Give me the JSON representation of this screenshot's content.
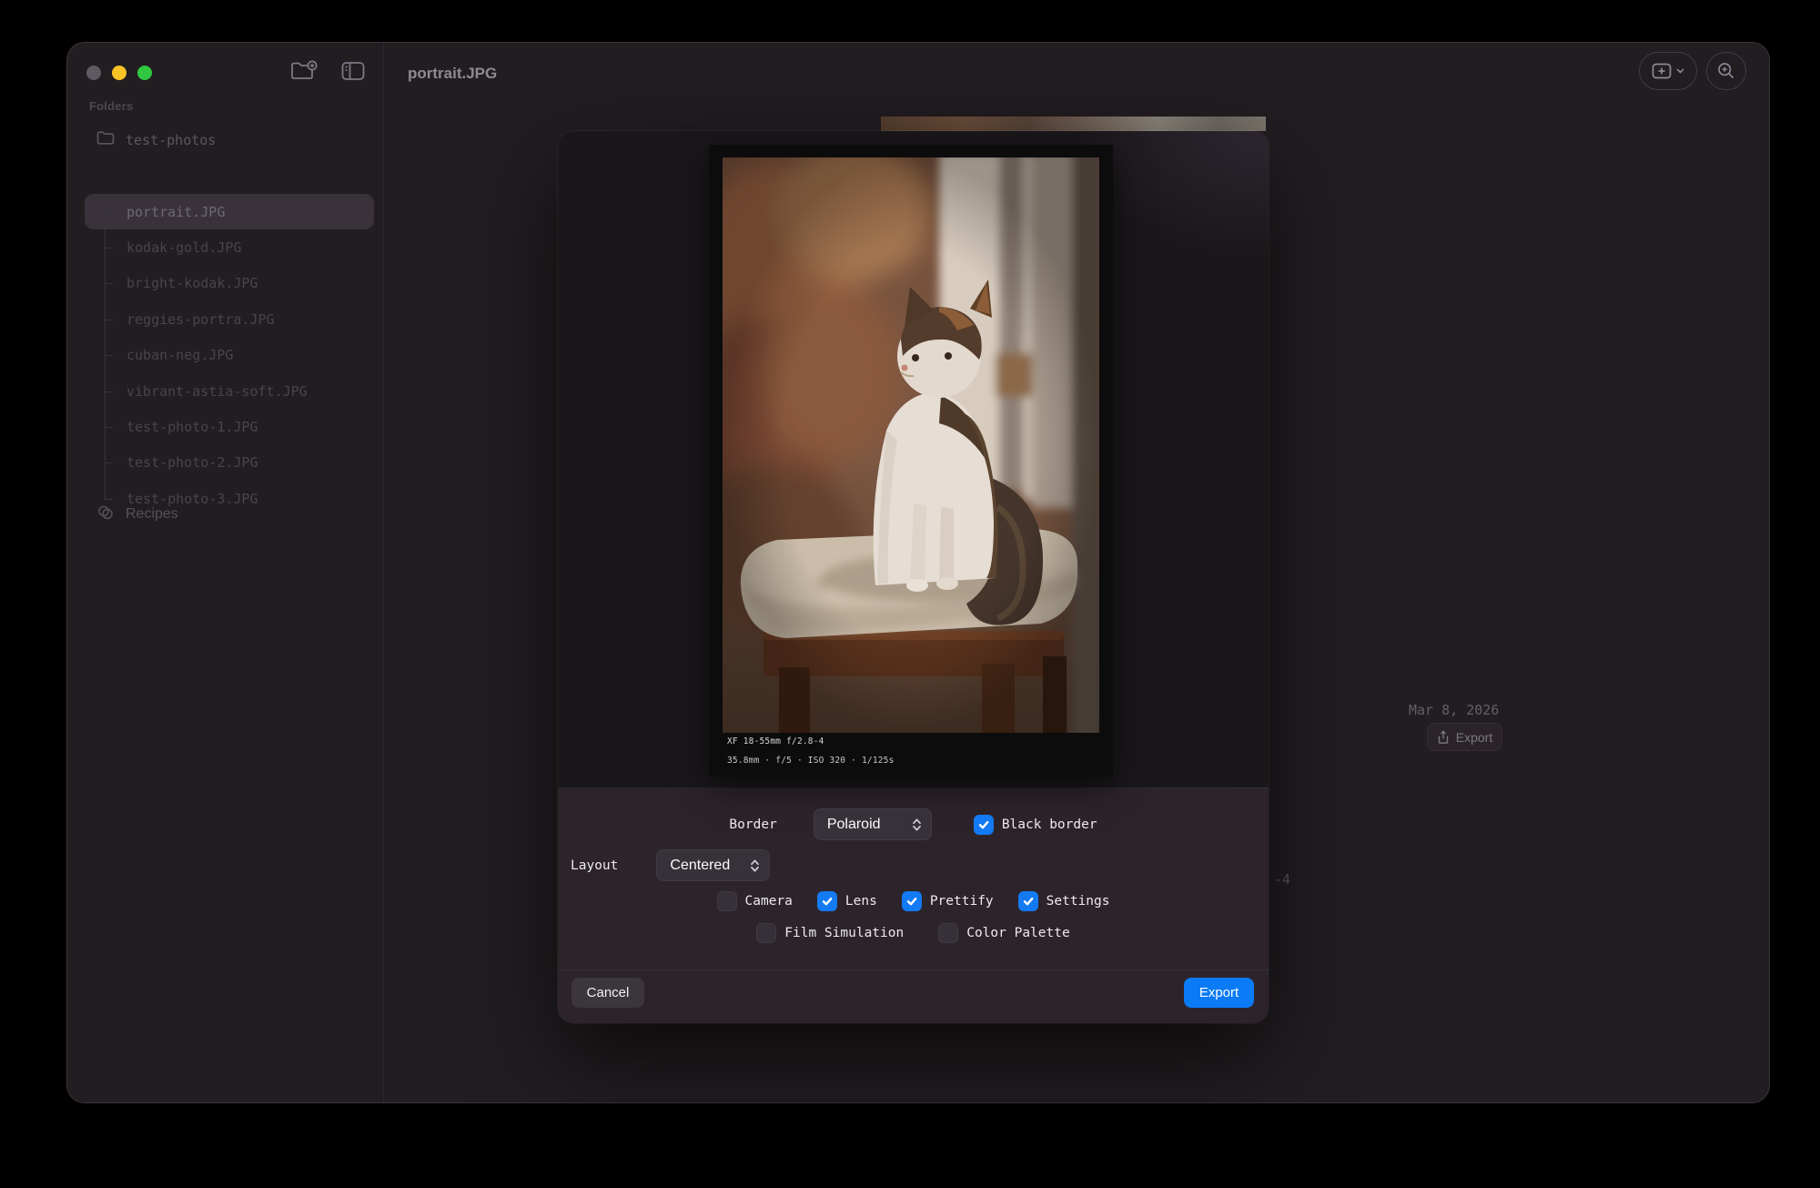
{
  "titlebar": {
    "title": "portrait.JPG"
  },
  "sidebar": {
    "section_label": "Folders",
    "folder_name": "test-photos",
    "files": [
      {
        "name": "portrait.JPG",
        "selected": true
      },
      {
        "name": "kodak-gold.JPG"
      },
      {
        "name": "bright-kodak.JPG"
      },
      {
        "name": "reggies-portra.JPG"
      },
      {
        "name": "cuban-neg.JPG"
      },
      {
        "name": "vibrant-astia-soft.JPG"
      },
      {
        "name": "test-photo-1.JPG"
      },
      {
        "name": "test-photo-2.JPG"
      },
      {
        "name": "test-photo-3.JPG",
        "last": true
      }
    ],
    "recipes_label": "Recipes"
  },
  "background_content": {
    "date": "Mar 8, 2026",
    "export_label": "Export",
    "clipped_fragment": "-4"
  },
  "dialog": {
    "exif": {
      "line1": "XF 18-55mm f/2.8-4",
      "line2": "35.8mm · f/5 · ISO 320 · 1/125s"
    },
    "border_row": {
      "label": "Border",
      "value": "Polaroid",
      "black_border": {
        "label": "Black border",
        "checked": true
      }
    },
    "layout_row": {
      "label": "Layout",
      "value": "Centered"
    },
    "meta_toggles": [
      {
        "label": "Camera",
        "checked": false
      },
      {
        "label": "Lens",
        "checked": true
      },
      {
        "label": "Prettify",
        "checked": true
      },
      {
        "label": "Settings",
        "checked": true
      }
    ],
    "extra_toggles": [
      {
        "label": "Film Simulation",
        "checked": false
      },
      {
        "label": "Color Palette",
        "checked": false
      }
    ],
    "cancel_label": "Cancel",
    "export_label": "Export"
  },
  "colors": {
    "accent_blue": "#0b7bf5",
    "checkbox_blue": "#147af3",
    "traffic_yellow": "#f7c325",
    "traffic_green": "#2fc840"
  }
}
